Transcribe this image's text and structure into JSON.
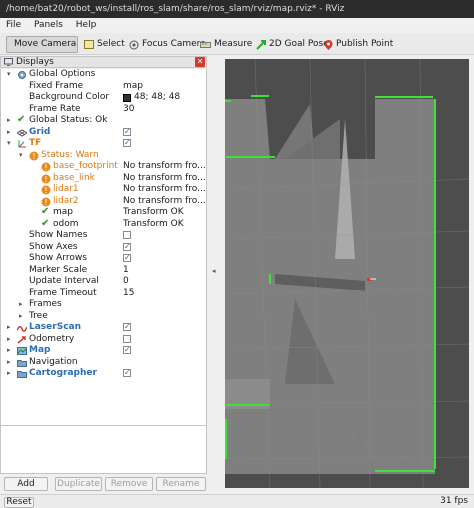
{
  "window": {
    "title": "/home/bat20/robot_ws/install/ros_slam/share/ros_slam/rviz/map.rviz* - RViz"
  },
  "menu": {
    "file": "File",
    "panels": "Panels",
    "help": "Help"
  },
  "toolbar": {
    "move_camera": "Move Camera",
    "select": "Select",
    "focus_camera": "Focus Camera",
    "measure": "Measure",
    "goal_pose": "2D Goal Pose",
    "publish_point": "Publish Point"
  },
  "displays_panel": {
    "title": "Displays",
    "rows": [
      {
        "label": "Global Options",
        "value": ""
      },
      {
        "label": "Fixed Frame",
        "value": "map"
      },
      {
        "label": "Background Color",
        "value": "48; 48; 48"
      },
      {
        "label": "Frame Rate",
        "value": "30"
      },
      {
        "label": "Global Status: Ok",
        "value": ""
      },
      {
        "label": "Grid",
        "value": ""
      },
      {
        "label": "TF",
        "value": ""
      },
      {
        "label": "Status: Warn",
        "value": ""
      },
      {
        "label": "base_footprint",
        "value": "No transform fro..."
      },
      {
        "label": "base_link",
        "value": "No transform fro..."
      },
      {
        "label": "lidar1",
        "value": "No transform fro..."
      },
      {
        "label": "lidar2",
        "value": "No transform fro..."
      },
      {
        "label": "map",
        "value": "Transform OK"
      },
      {
        "label": "odom",
        "value": "Transform OK"
      },
      {
        "label": "Show Names",
        "value": ""
      },
      {
        "label": "Show Axes",
        "value": ""
      },
      {
        "label": "Show Arrows",
        "value": ""
      },
      {
        "label": "Marker Scale",
        "value": "1"
      },
      {
        "label": "Update Interval",
        "value": "0"
      },
      {
        "label": "Frame Timeout",
        "value": "15"
      },
      {
        "label": "Frames",
        "value": ""
      },
      {
        "label": "Tree",
        "value": ""
      },
      {
        "label": "LaserScan",
        "value": ""
      },
      {
        "label": "Odometry",
        "value": ""
      },
      {
        "label": "Map",
        "value": ""
      },
      {
        "label": "Navigation",
        "value": ""
      },
      {
        "label": "Cartographer",
        "value": ""
      }
    ],
    "checkboxes": {
      "grid": true,
      "tf": true,
      "show_names": false,
      "show_axes": true,
      "show_arrows": true,
      "laserscan": true,
      "odometry": false,
      "map": true,
      "cartographer": true
    },
    "background_color_swatch": "#303030"
  },
  "buttons": {
    "add": "Add",
    "duplicate": "Duplicate",
    "remove": "Remove",
    "rename": "Rename"
  },
  "status": {
    "reset": "Reset",
    "fps": "31 fps"
  },
  "colors": {
    "accent_blue": "#2a6db5",
    "warn_orange": "#e07b10",
    "ok_green": "#2f8f2f",
    "map_green": "#3fe03a",
    "map_free": "#7f7f7f",
    "map_unknown": "#4d4d4d"
  }
}
